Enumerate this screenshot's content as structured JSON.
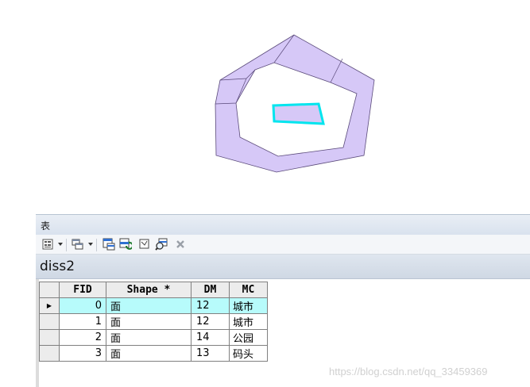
{
  "window": {
    "title": "表"
  },
  "toolbar": {
    "icons": [
      "table-options-icon",
      "related-tables-icon",
      "select-by-attributes-icon",
      "switch-selection-icon",
      "clear-selection-icon",
      "zoom-to-selected-icon",
      "delete-selected-icon"
    ]
  },
  "table": {
    "name": "diss2",
    "columns": [
      "FID",
      "Shape *",
      "DM",
      "MC"
    ],
    "rows": [
      {
        "fid": "0",
        "shape": "面",
        "dm": "12",
        "mc": "城市",
        "selected": true
      },
      {
        "fid": "1",
        "shape": "面",
        "dm": "12",
        "mc": "城市",
        "selected": false
      },
      {
        "fid": "2",
        "shape": "面",
        "dm": "14",
        "mc": "公园",
        "selected": false
      },
      {
        "fid": "3",
        "shape": "面",
        "dm": "13",
        "mc": "码头",
        "selected": false
      }
    ]
  },
  "map": {
    "fill_color": "#d6c8f7",
    "stroke_color": "#5a4a7a",
    "selection_color": "#00e5ee"
  },
  "watermark": "https://blog.csdn.net/qq_33459369"
}
